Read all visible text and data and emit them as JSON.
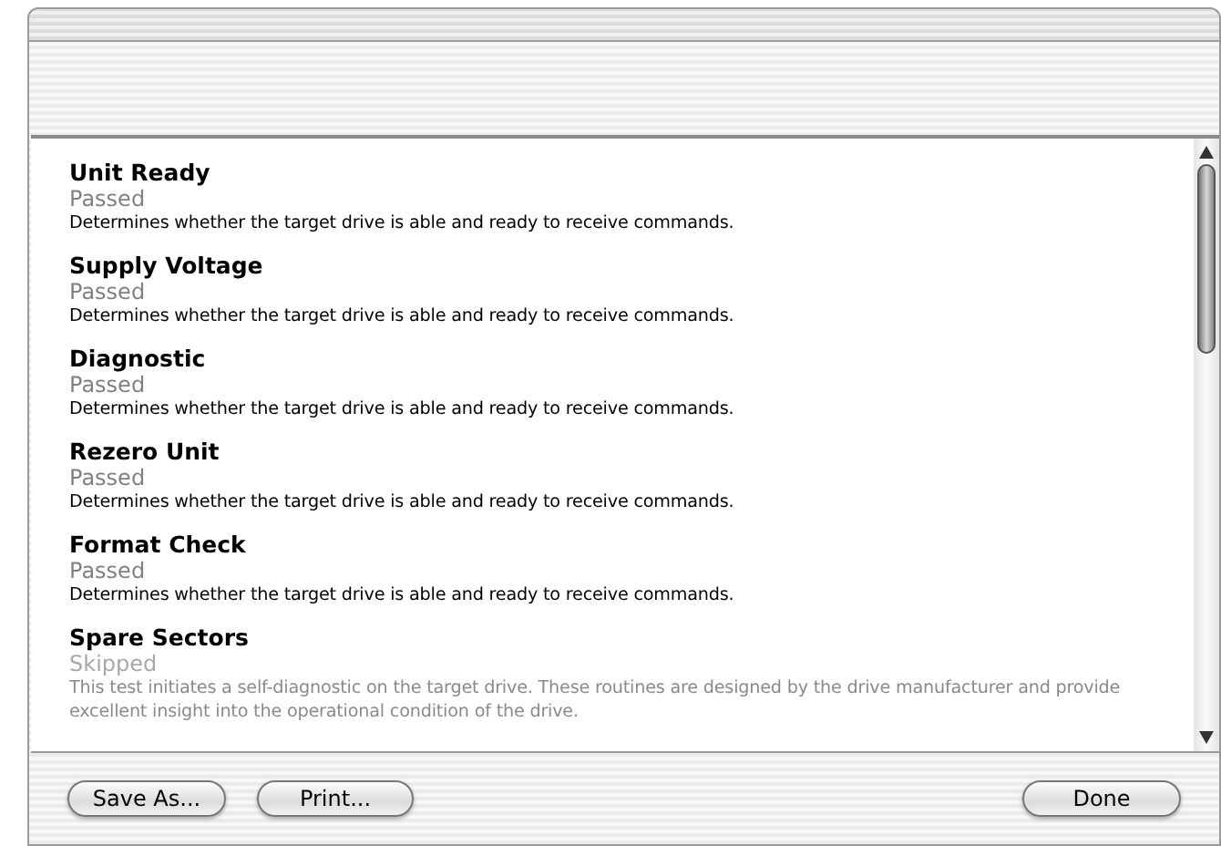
{
  "tests": [
    {
      "title": "Unit Ready",
      "status": "Passed",
      "kind": "passed",
      "description": "Determines whether the target drive is able and ready to receive commands."
    },
    {
      "title": "Supply Voltage",
      "status": "Passed",
      "kind": "passed",
      "description": "Determines whether the target drive is able and ready to receive commands."
    },
    {
      "title": "Diagnostic",
      "status": "Passed",
      "kind": "passed",
      "description": "Determines whether the target drive is able and ready to receive commands."
    },
    {
      "title": "Rezero Unit",
      "status": "Passed",
      "kind": "passed",
      "description": "Determines whether the target drive is able and ready to receive commands."
    },
    {
      "title": "Format Check",
      "status": "Passed",
      "kind": "passed",
      "description": "Determines whether the target drive is able and ready to receive commands."
    },
    {
      "title": "Spare Sectors",
      "status": "Skipped",
      "kind": "skipped",
      "description": "This test initiates a self-diagnostic on the target drive. These routines are designed by the drive manufacturer and provide excellent insight into the operational condition of the drive."
    }
  ],
  "buttons": {
    "left": [
      "Save As...",
      "Print..."
    ],
    "right": "Done"
  }
}
